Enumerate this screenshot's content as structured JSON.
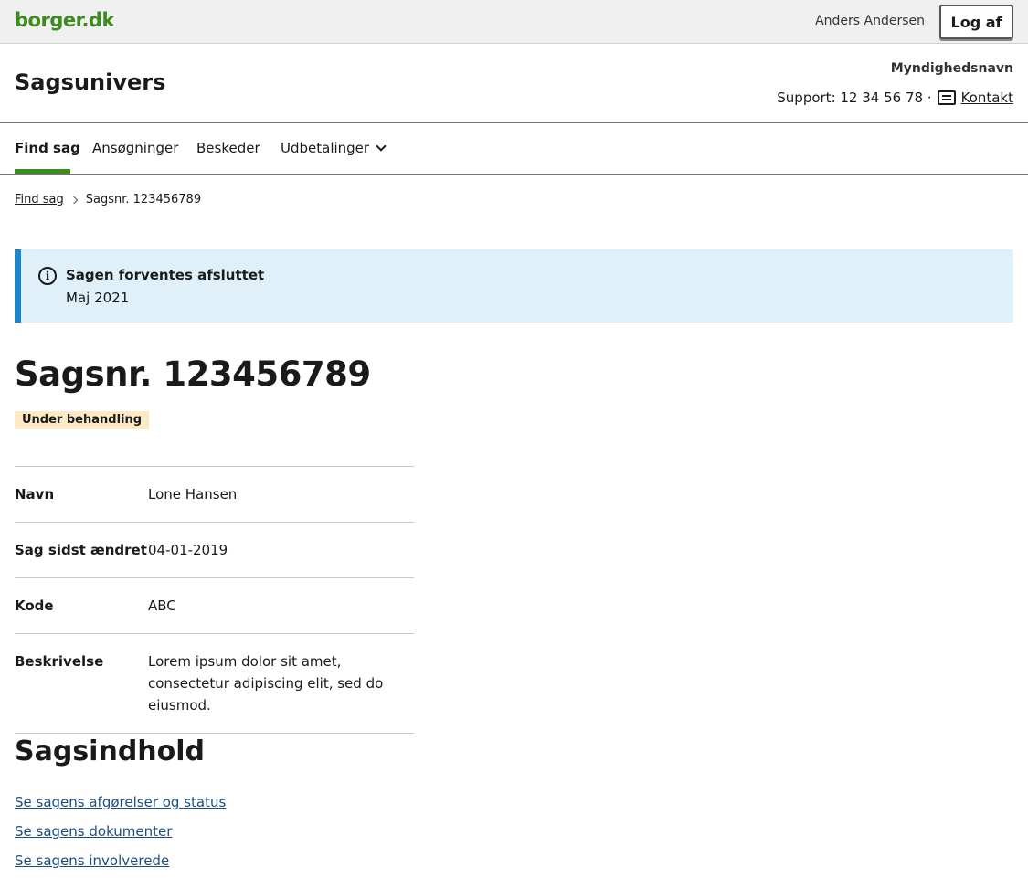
{
  "topbar": {
    "logo_text": "borger.dk",
    "user_name": "Anders Andersen",
    "logout_label": "Log af"
  },
  "header": {
    "app_title": "Sagsunivers",
    "authority_name": "Myndighedsnavn",
    "support_text": "Support: 12 34 56 78 ·",
    "contact_label": "Kontakt"
  },
  "nav": {
    "items": [
      {
        "label": "Find sag",
        "active": true
      },
      {
        "label": "Ansøgninger"
      },
      {
        "label": "Beskeder"
      },
      {
        "label": "Udbetalinger"
      }
    ]
  },
  "breadcrumb": {
    "items": [
      "Find sag",
      "Sagsnr. 123456789"
    ]
  },
  "alert": {
    "title": "Sagen forventes afsluttet",
    "body": "Maj 2021"
  },
  "case": {
    "title": "Sagsnr. 123456789",
    "status": "Under behandling",
    "details": [
      {
        "key": "Navn",
        "value": "Lone Hansen"
      },
      {
        "key": "Sag sidst ændret",
        "value": "04-01-2019"
      },
      {
        "key": "Kode",
        "value": "ABC"
      },
      {
        "key": "Beskrivelse",
        "value": "Lorem ipsum dolor sit amet, consectetur adipiscing elit, sed do eiusmod."
      }
    ]
  },
  "contents": {
    "title": "Sagsindhold",
    "links": [
      "Se sagens afgørelser og status",
      "Se sagens dokumenter",
      "Se sagens involverede"
    ]
  },
  "colors": {
    "brand_green": "#3d8b1f",
    "info_blue": "#1b86c7",
    "info_bg": "#dff0f8",
    "badge_bg": "#fce9c5",
    "link_blue": "#1b4e80"
  }
}
